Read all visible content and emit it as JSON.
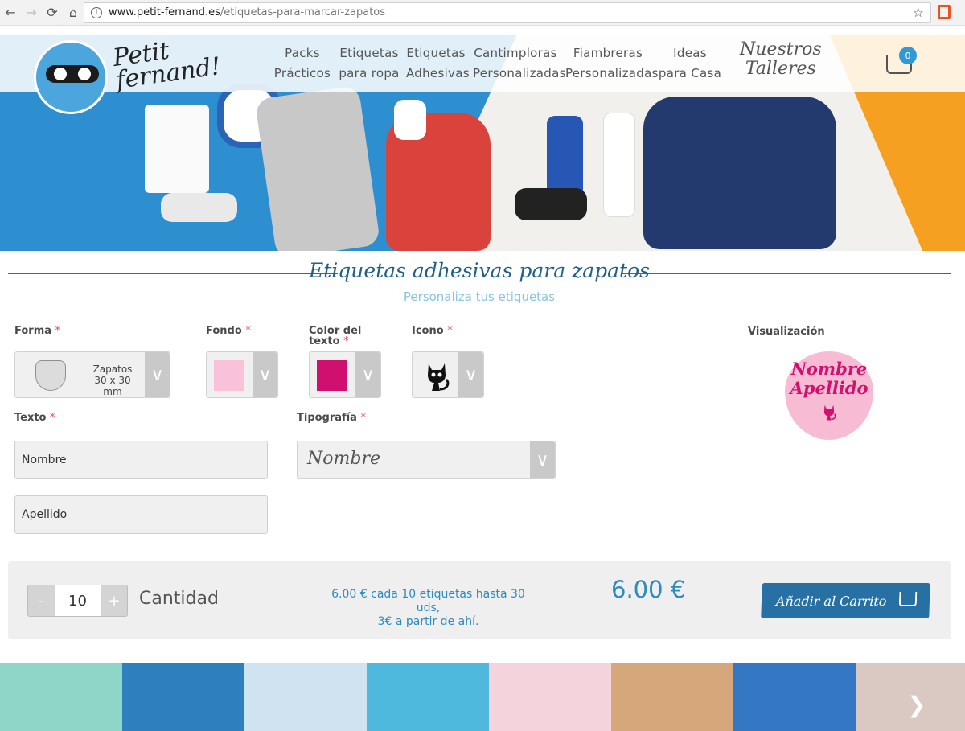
{
  "browser": {
    "url_host": "www.petit-fernand.es",
    "url_path": "/etiquetas-para-marcar-zapatos",
    "back_icon": "arrow-left-icon",
    "forward_icon": "arrow-right-icon",
    "reload_icon": "reload-icon",
    "home_icon": "home-icon",
    "info_icon": "info-icon",
    "info_glyph": "i",
    "star_icon": "star-icon",
    "extension_icon": "office-icon"
  },
  "header": {
    "logo_line1": "Petit",
    "logo_line2": "fernand!",
    "nav": [
      {
        "line1": "Packs",
        "line2": "Prácticos"
      },
      {
        "line1": "Etiquetas",
        "line2": "para ropa"
      },
      {
        "line1": "Etiquetas",
        "line2": "Adhesivas"
      },
      {
        "line1": "Cantimploras",
        "line2": "Personalizadas"
      },
      {
        "line1": "Fiambreras",
        "line2": "Personalizadas"
      },
      {
        "line1": "Ideas",
        "line2": "para Casa"
      }
    ],
    "talleres_line1": "Nuestros",
    "talleres_line2": "Talleres",
    "cart_count": "0"
  },
  "page": {
    "title": "Etiquetas adhesivas para zapatos",
    "subtitle": "Personaliza tus etiquetas"
  },
  "form": {
    "required_mark": "*",
    "forma_label": "Forma",
    "forma_value_line1": "Zapatos",
    "forma_value_line2": "30 x 30 mm",
    "fondo_label": "Fondo",
    "fondo_color": "#f9c2da",
    "color_texto_label_line1": "Color del",
    "color_texto_label_line2": "texto",
    "color_texto_color": "#d0106e",
    "icono_label": "Icono",
    "icono_value": "cat-icon",
    "texto_label": "Texto",
    "texto_nombre": "Nombre",
    "texto_apellido": "Apellido",
    "tipografia_label": "Tipografía",
    "tipografia_value": "Nombre",
    "preview_label": "Visualización",
    "preview_line1": "Nombre",
    "preview_line2": "Apellido"
  },
  "purchase": {
    "minus": "-",
    "plus": "+",
    "quantity": "10",
    "quantity_label": "Cantidad",
    "price_note_line1": "6.00 € cada 10 etiquetas hasta 30 uds,",
    "price_note_line2": "3€ a partir de ahí.",
    "price": "6.00 €",
    "add_to_cart": "Añadir al Carrito"
  },
  "colors": {
    "brand_blue": "#2770a3",
    "accent_light": "#2c8bbf",
    "hero_blue": "#2e8fd0",
    "hero_orange": "#f5a021"
  },
  "gallery": {
    "next_glyph": "❯",
    "tiles": [
      "#8fd6c8",
      "#2d7fbd",
      "#cfe4f0",
      "#4fb8dd",
      "#f4d3dc",
      "#d6a77a",
      "#3478c4",
      "#d9c9c2"
    ]
  }
}
